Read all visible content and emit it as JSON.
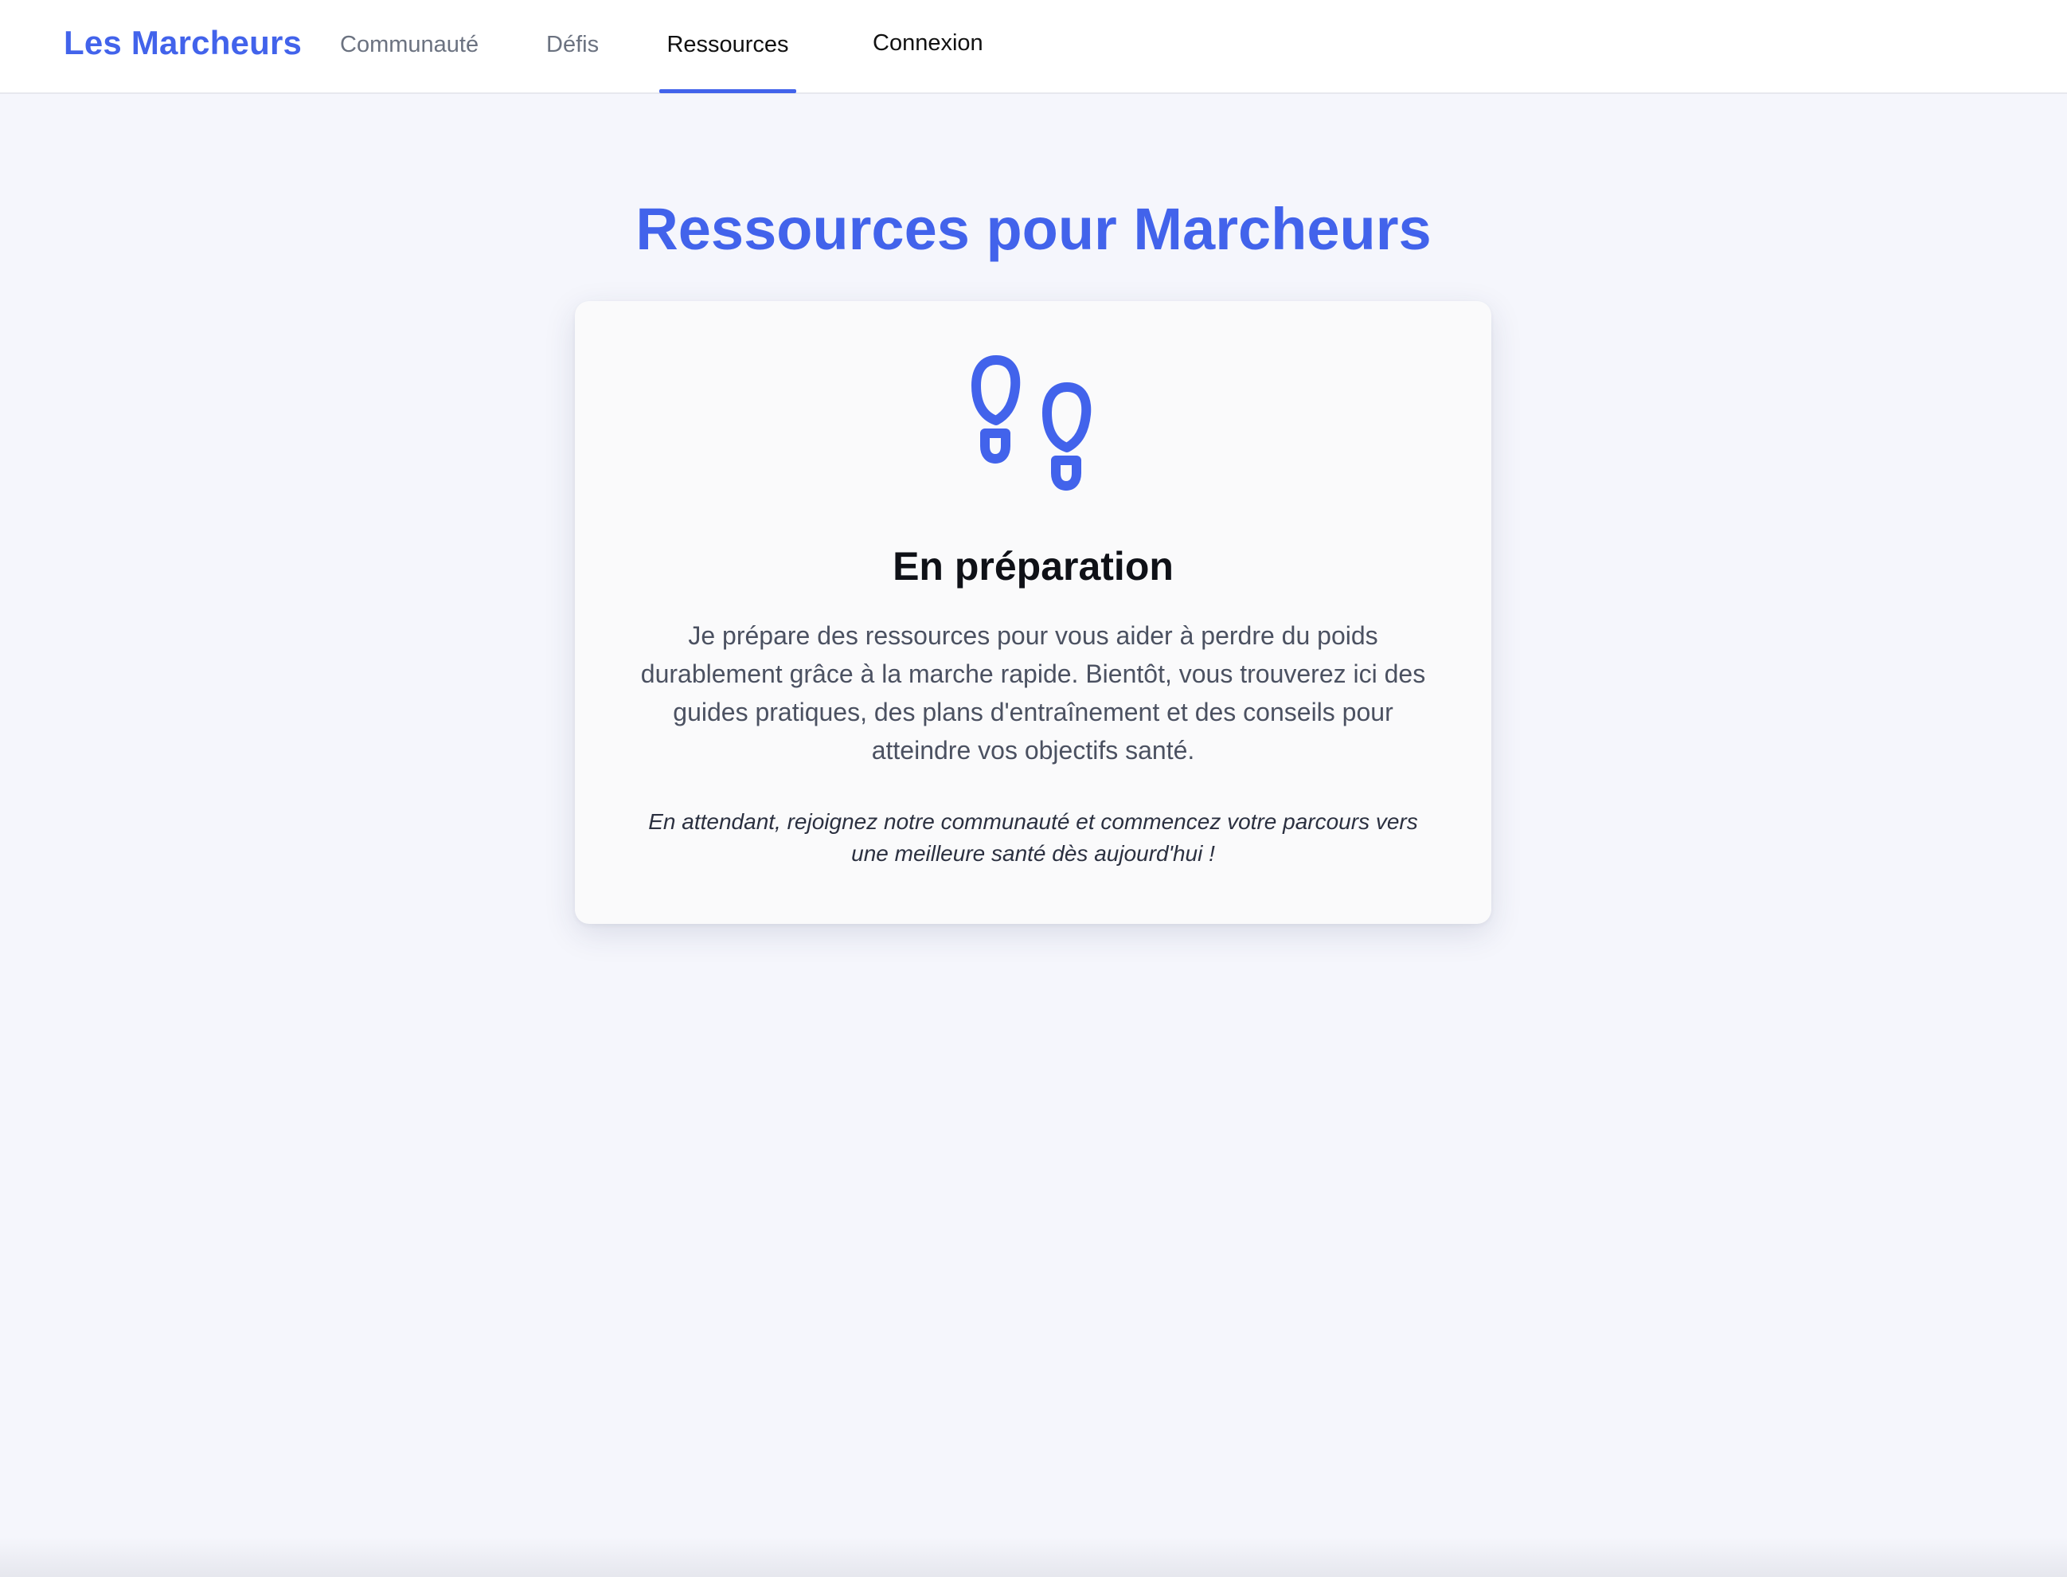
{
  "nav": {
    "brand": "Les Marcheurs",
    "links": [
      {
        "label": "Communauté",
        "active": false
      },
      {
        "label": "Défis",
        "active": false
      },
      {
        "label": "Ressources",
        "active": true
      }
    ],
    "login_label": "Connexion"
  },
  "main": {
    "title": "Ressources pour Marcheurs",
    "card": {
      "icon": "footsteps-icon",
      "heading": "En préparation",
      "description": "Je prépare des ressources pour vous aider à perdre du poids durablement grâce à la marche rapide. Bientôt, vous trouverez ici des guides pratiques, des plans d'entraînement et des conseils pour atteindre vos objectifs santé.",
      "note": "En attendant, rejoignez notre communauté et commencez votre parcours vers une meilleure santé dès aujourd'hui !"
    }
  },
  "colors": {
    "accent": "#4263eb",
    "background": "#f5f6fc",
    "card": "#fafafb",
    "text_dark": "#0f1117",
    "text_muted": "#4b5161"
  }
}
